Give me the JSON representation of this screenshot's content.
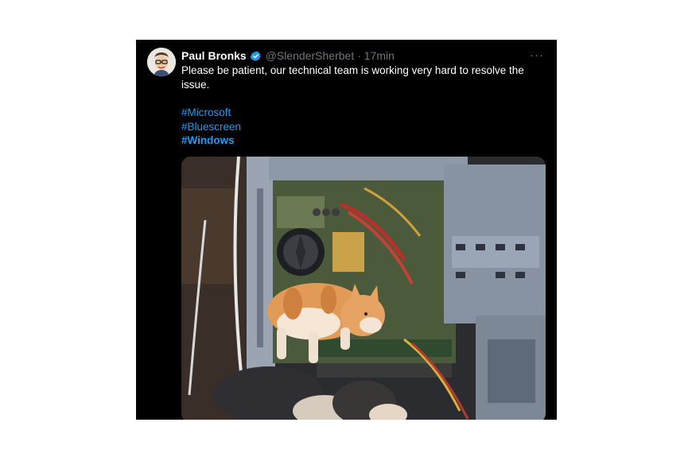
{
  "tweet": {
    "author": {
      "name": "Paul Bronks",
      "handle": "@SlenderSherbet",
      "time": "· 17min",
      "avatar_icon": "cartoon-face-avatar",
      "verified_icon": "verified-badge-icon"
    },
    "more_label": "···",
    "text": "Please be patient, our technical team is working very hard to resolve the issue.",
    "hashtags": [
      {
        "label": "#Microsoft"
      },
      {
        "label": "#Bluescreen"
      },
      {
        "label": "#Windows"
      }
    ],
    "media": {
      "kind": "photo",
      "subject": "kittens-inside-computer-case"
    }
  },
  "colors": {
    "tweet_bg": "#000000",
    "text": "#ffffff",
    "muted": "#71767b",
    "link": "#1d9bf0",
    "verified": "#1d9bf0"
  }
}
